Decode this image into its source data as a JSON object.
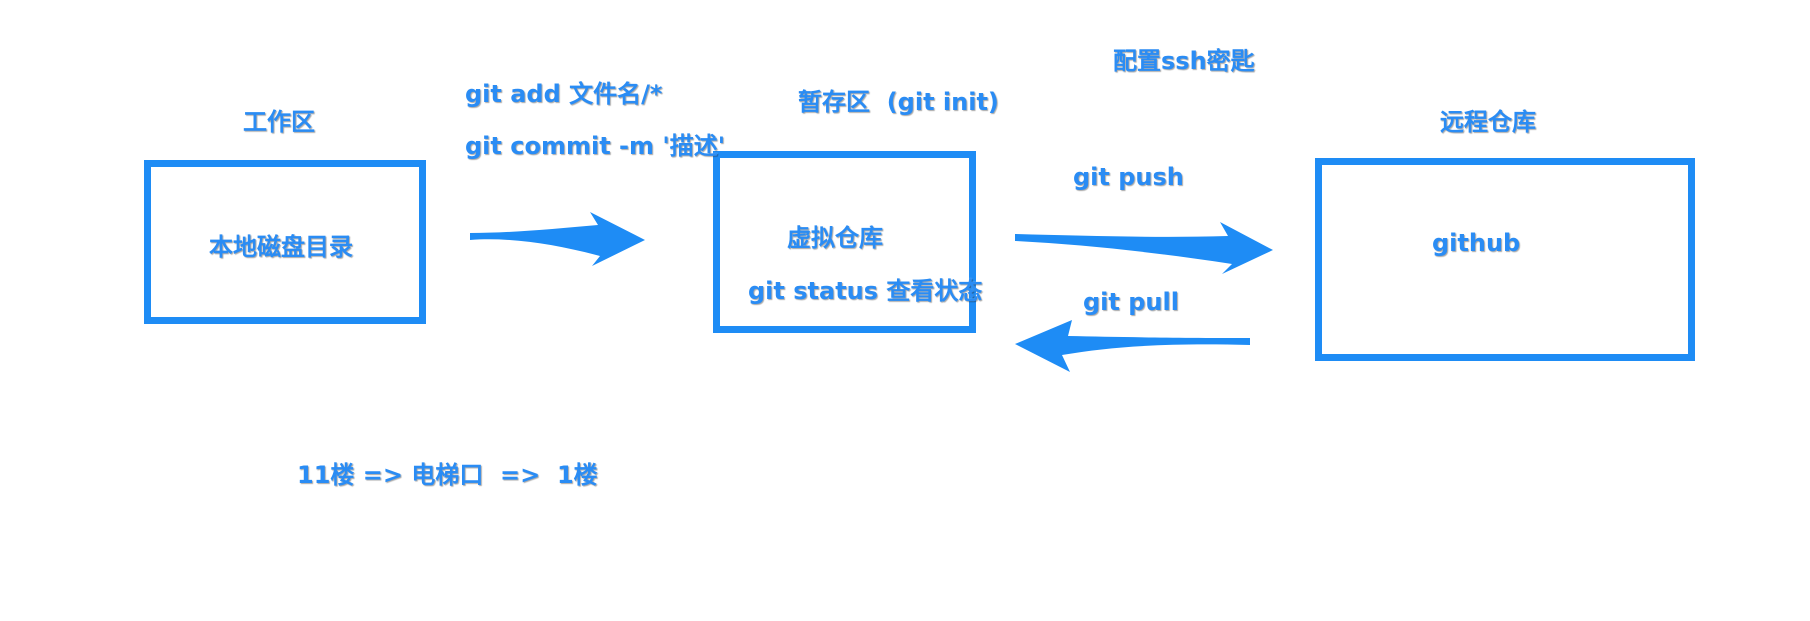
{
  "colors": {
    "accent": "#1e8cf5",
    "label": "#2a8cf4"
  },
  "workspace": {
    "title": "工作区",
    "box_label": "本地磁盘目录"
  },
  "commands": {
    "add": "git add 文件名/*",
    "commit": "git commit -m '描述'"
  },
  "staging": {
    "title": "暂存区  (git init)",
    "box_label": "虚拟仓库",
    "status": "git status 查看状态"
  },
  "ssh": {
    "label": "配置ssh密匙"
  },
  "push": {
    "label": "git push"
  },
  "pull": {
    "label": "git pull"
  },
  "remote": {
    "title": "远程仓库",
    "box_label": "github"
  },
  "analogy": {
    "text": "11楼 => 电梯口  =>  1楼"
  }
}
